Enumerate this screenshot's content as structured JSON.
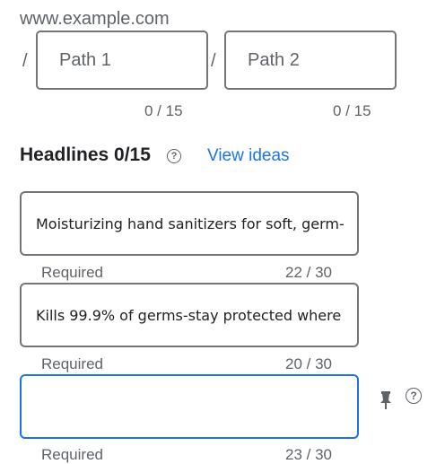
{
  "display_url": {
    "domain": "www.example.com",
    "separator": "/",
    "paths": [
      {
        "placeholder": "Path 1",
        "counter": "0 / 15"
      },
      {
        "placeholder": "Path 2",
        "counter": "0 / 15"
      }
    ]
  },
  "headlines": {
    "title": "Headlines 0/15",
    "help_icon": "?",
    "view_ideas_label": "View ideas",
    "items": [
      {
        "value": "Moisturizing hand sanitizers for soft, germ-",
        "hint": "Required",
        "counter": "22 / 30"
      },
      {
        "value": "Kills 99.9% of germs-stay protected where",
        "hint": "Required",
        "counter": "20 / 30"
      },
      {
        "value": "",
        "hint": "Required",
        "counter": "23 / 30"
      }
    ],
    "pin_icon": "pin-icon",
    "item_help_icon": "?"
  },
  "colors": {
    "accent": "#1a73e8",
    "border": "#757575",
    "muted_text": "#5f6368"
  }
}
